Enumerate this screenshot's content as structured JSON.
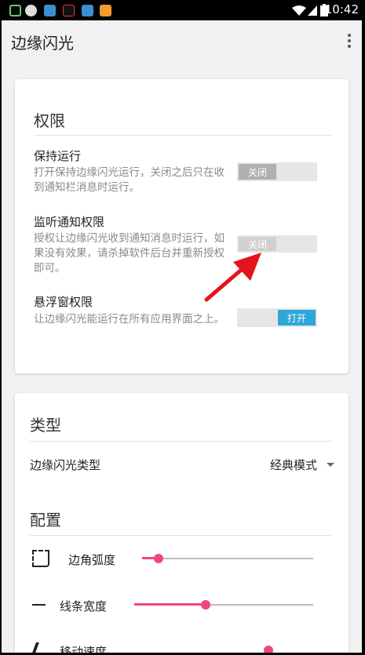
{
  "status_bar": {
    "time": "10:42"
  },
  "app_bar": {
    "title": "边缘闪光",
    "menu_icon": "more-vert-icon"
  },
  "permissions": {
    "title": "权限",
    "items": [
      {
        "title": "保持运行",
        "desc": "打开保持边缘闪光运行，关闭之后只在收到通知栏消息时运行。",
        "toggle": "关闭",
        "state": "off"
      },
      {
        "title": "监听通知权限",
        "desc": "授权让边缘闪光收到通知消息时运行，如果没有效果，请杀掉软件后台并重新授权即可。",
        "toggle": "关闭",
        "state": "off"
      },
      {
        "title": "悬浮窗权限",
        "desc": "让边缘闪光能运行在所有应用界面之上。",
        "toggle": "打开",
        "state": "on"
      }
    ]
  },
  "type_section": {
    "title": "类型",
    "row_label": "边缘闪光类型",
    "value": "经典模式"
  },
  "config_section": {
    "title": "配置",
    "sliders": [
      {
        "label": "边角弧度",
        "icon": "corner-radius-icon",
        "value_fraction": 0.09
      },
      {
        "label": "线条宽度",
        "icon": "line-width-icon",
        "value_fraction": 0.4
      },
      {
        "label": "移动速度",
        "icon": "speed-icon",
        "value_fraction": 0.75
      }
    ]
  },
  "colors": {
    "accent": "#f0457c",
    "toggle_on": "#2da6d8",
    "annotation_arrow": "#e3141b"
  }
}
